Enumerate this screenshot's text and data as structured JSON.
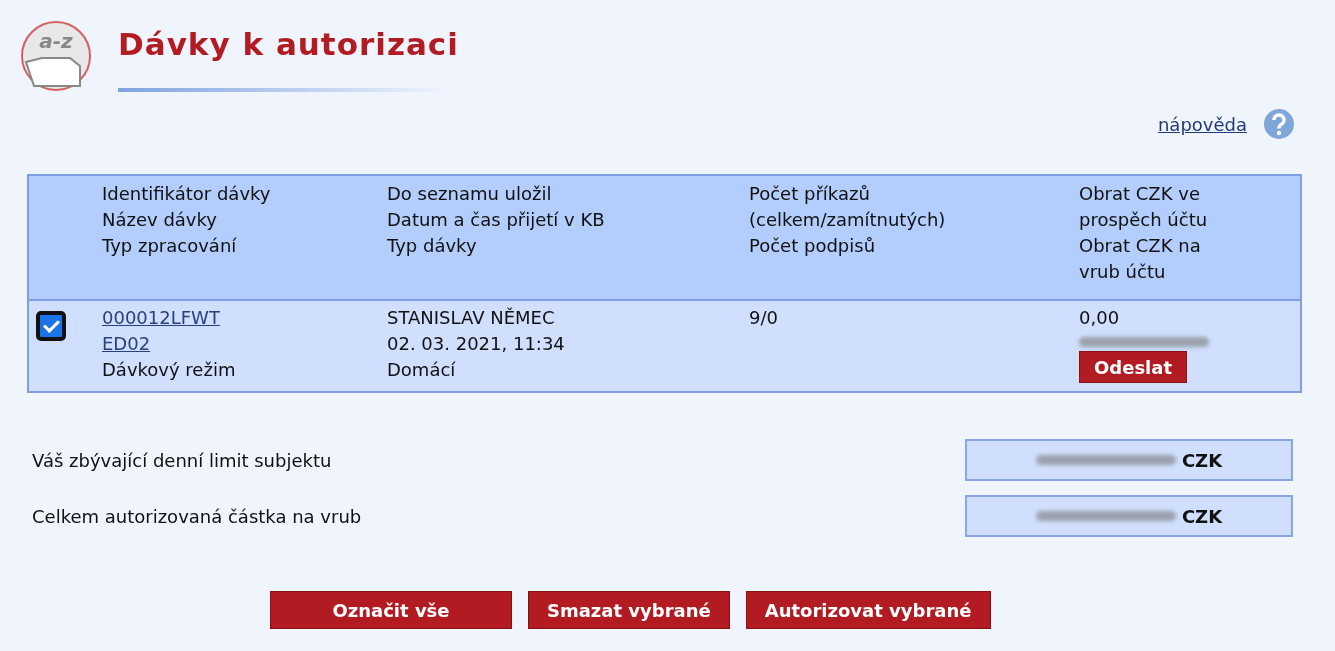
{
  "page": {
    "logo_text": "a-z",
    "title": "Dávky k autorizaci",
    "help_link": "nápověda"
  },
  "table": {
    "columns": [
      {
        "lines": [
          "Identifikátor dávky",
          "Název dávky",
          "Typ zpracování"
        ]
      },
      {
        "lines": [
          "Do seznamu uložil",
          "Datum a čas přijetí v KB",
          "Typ dávky"
        ]
      },
      {
        "lines": [
          "Počet příkazů",
          "(celkem/zamítnutých)",
          "Počet podpisů"
        ]
      },
      {
        "lines": [
          "Obrat CZK ve",
          "prospěch účtu",
          "Obrat CZK na",
          "vrub účtu"
        ]
      }
    ],
    "rows": [
      {
        "checked": true,
        "id_links": [
          "000012LFWT",
          "ED02"
        ],
        "processing": "Dávkový režim",
        "saved_by": "STANISLAV NĚMEC",
        "received": "02. 03. 2021, 11:34",
        "batch_type": "Domácí",
        "count": "9/0",
        "credit": "0,00",
        "send_button": "Odeslat"
      }
    ]
  },
  "limits": [
    {
      "label": "Váš zbývající denní limit subjektu",
      "currency": "CZK"
    },
    {
      "label": "Celkem autorizovaná částka na vrub",
      "currency": "CZK"
    }
  ],
  "buttons": [
    "Označit vše",
    "Smazat vybrané",
    "Autorizovat vybrané"
  ]
}
